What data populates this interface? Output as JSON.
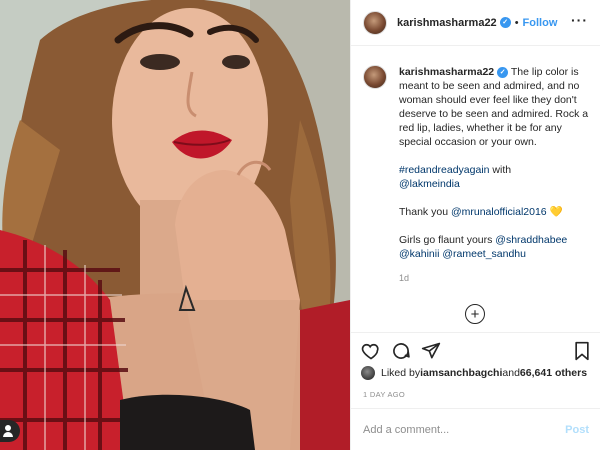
{
  "header": {
    "username": "karishmasharma22",
    "verified_icon": "verified-badge-icon",
    "separator": "•",
    "follow_label": "Follow",
    "more_icon": "more-options-icon"
  },
  "caption": {
    "username": "karishmasharma22",
    "body": "The lip color is meant to be seen and admired, and no woman should ever feel like they don't deserve to be seen and admired. Rock a red lip, ladies, whether it be for any special occasion or your own.",
    "hashtag": "#redandreadyagain",
    "with_text": " with",
    "mention_brand": "@lakmeindia",
    "thanks_prefix": "Thank you ",
    "mention_thanks": "@mrunalofficial2016",
    "heart": "♡",
    "flaunt_prefix": "Girls go flaunt yours ",
    "mention_1": "@shraddhabee",
    "mention_2": "@kahinii",
    "mention_3": "@rameet_sandhu",
    "time": "1d",
    "load_more_icon": "plus-circle-icon"
  },
  "likes": {
    "prefix": "Liked by ",
    "liker": "iamsanchbagchi",
    "middle": " and ",
    "others": "66,641 others"
  },
  "post_time": "1 DAY AGO",
  "comment": {
    "placeholder": "Add a comment...",
    "post_label": "Post"
  },
  "colors": {
    "accent": "#3897f0",
    "link": "#00376b",
    "muted": "#8e8e8e",
    "post_disabled": "#b2dffc"
  }
}
